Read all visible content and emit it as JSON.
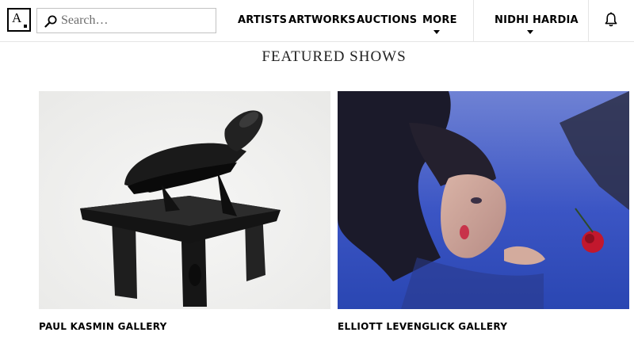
{
  "header": {
    "logo_text": "A",
    "search": {
      "placeholder": "Search…",
      "value": ""
    },
    "nav": [
      {
        "label": "ARTISTS"
      },
      {
        "label": "ARTWORKS"
      },
      {
        "label": "AUCTIONS"
      },
      {
        "label": "MORE"
      }
    ],
    "user_name": "NIDHI HARDIA"
  },
  "main": {
    "section_title": "FEATURED SHOWS",
    "shows": [
      {
        "gallery": "PAUL KASMIN GALLERY"
      },
      {
        "gallery": "ELLIOTT LEVENGLICK GALLERY"
      }
    ]
  },
  "icons": [
    "logo",
    "search-icon",
    "chevron-down-icon",
    "bell-icon"
  ],
  "colors": {
    "text": "#000000",
    "border": "#c2c2c2",
    "divider": "#e5e5e5"
  }
}
